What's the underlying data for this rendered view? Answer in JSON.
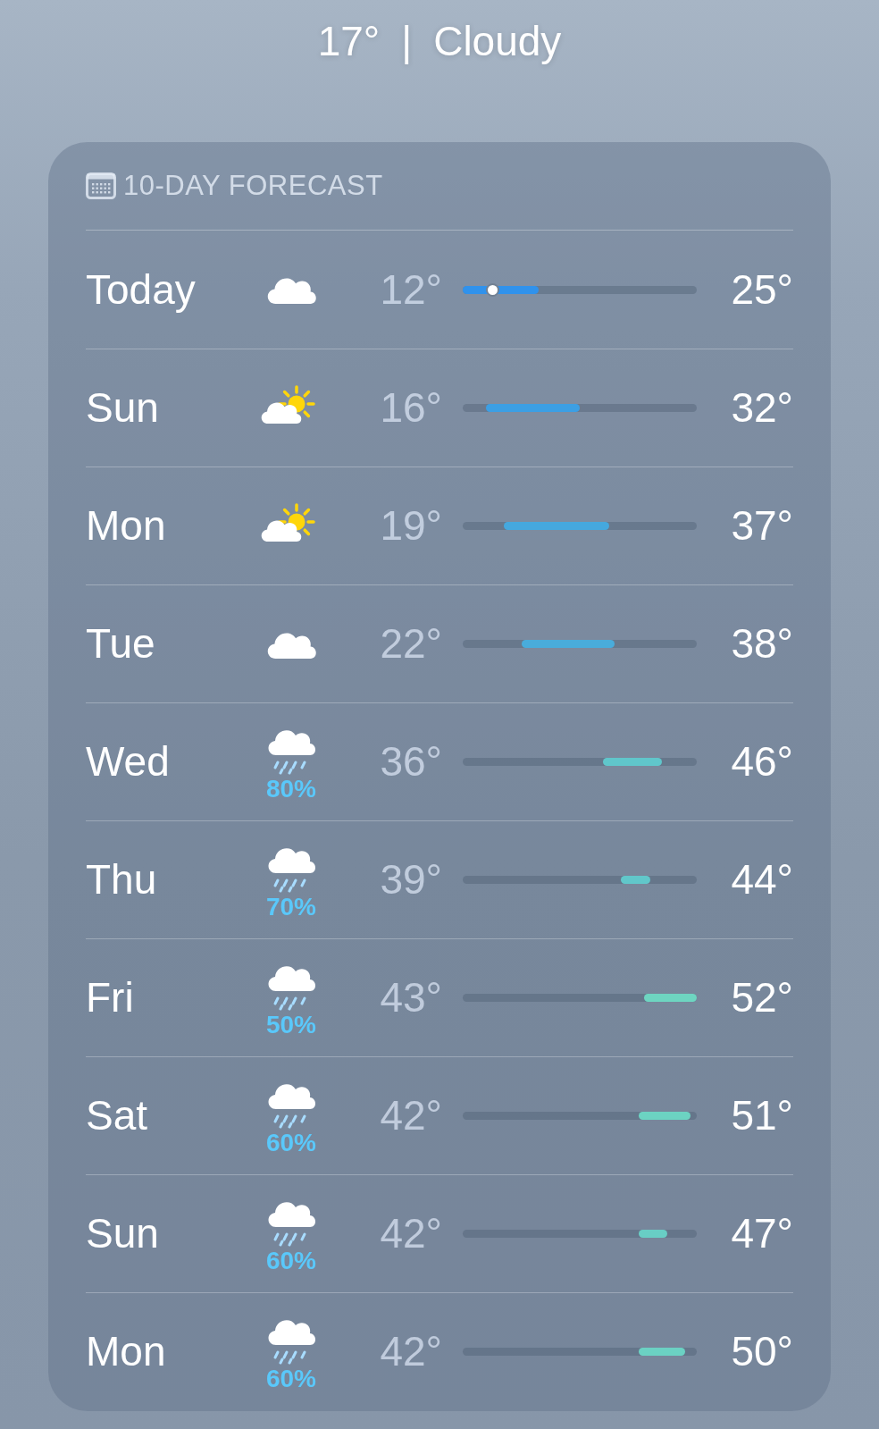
{
  "current": {
    "temperature": "17°",
    "separator": "|",
    "condition": "Cloudy"
  },
  "forecast": {
    "title": "10-DAY FORECAST",
    "days": [
      {
        "day": "Today",
        "kind": "cloud",
        "low": "12°",
        "high": "25°",
        "current_marker": true
      },
      {
        "day": "Sun",
        "kind": "partly-sunny",
        "low": "16°",
        "high": "32°",
        "current_marker": false
      },
      {
        "day": "Mon",
        "kind": "partly-sunny",
        "low": "19°",
        "high": "37°",
        "current_marker": false
      },
      {
        "day": "Tue",
        "kind": "cloud",
        "low": "22°",
        "high": "38°",
        "current_marker": false
      },
      {
        "day": "Wed",
        "kind": "rain",
        "precipitation": "80%",
        "low": "36°",
        "high": "46°",
        "current_marker": false
      },
      {
        "day": "Thu",
        "kind": "rain",
        "precipitation": "70%",
        "low": "39°",
        "high": "44°",
        "current_marker": false
      },
      {
        "day": "Fri",
        "kind": "rain",
        "precipitation": "50%",
        "low": "43°",
        "high": "52°",
        "current_marker": false
      },
      {
        "day": "Sat",
        "kind": "rain",
        "precipitation": "60%",
        "low": "42°",
        "high": "51°",
        "current_marker": false
      },
      {
        "day": "Sun",
        "kind": "rain",
        "precipitation": "60%",
        "low": "42°",
        "high": "47°",
        "current_marker": false
      },
      {
        "day": "Mon",
        "kind": "rain",
        "precipitation": "60%",
        "low": "42°",
        "high": "50°",
        "current_marker": false
      }
    ]
  }
}
